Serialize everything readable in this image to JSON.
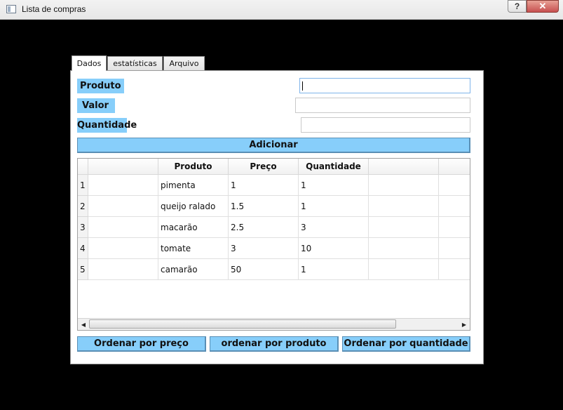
{
  "window": {
    "title": "Lista de compras",
    "help_label": "?",
    "close_label": "✕",
    "icon": "window-app-icon"
  },
  "tabs": [
    {
      "label": "Dados",
      "active": true
    },
    {
      "label": "estatísticas",
      "active": false
    },
    {
      "label": "Arquivo",
      "active": false
    }
  ],
  "form": {
    "produto_label": "Produto",
    "valor_label": "Valor",
    "quantidade_label": "Quantidade",
    "produto_value": "",
    "valor_value": "",
    "quantidade_value": "",
    "add_button": "Adicionar"
  },
  "table": {
    "headers": [
      "",
      "Produto",
      "Preço",
      "Quantidade",
      "",
      ""
    ],
    "rows": [
      {
        "num": "1",
        "cells": [
          "",
          "pimenta",
          "1",
          "1",
          "",
          ""
        ]
      },
      {
        "num": "2",
        "cells": [
          "",
          "queijo ralado",
          "1.5",
          "1",
          "",
          ""
        ]
      },
      {
        "num": "3",
        "cells": [
          "",
          "macarão",
          "2.5",
          "3",
          "",
          ""
        ]
      },
      {
        "num": "4",
        "cells": [
          "",
          "tomate",
          "3",
          "10",
          "",
          ""
        ]
      },
      {
        "num": "5",
        "cells": [
          "",
          "camarão",
          "50",
          "1",
          "",
          ""
        ]
      }
    ],
    "scroll_left": "◀",
    "scroll_right": "▶"
  },
  "actions": {
    "sort_price": "Ordenar por preço",
    "sort_product": "ordenar por produto",
    "sort_quantity": "Ordenar por quantidade"
  },
  "colors": {
    "label_bg": "#87cefa",
    "button_bg": "#87cefa",
    "background": "#000000"
  }
}
